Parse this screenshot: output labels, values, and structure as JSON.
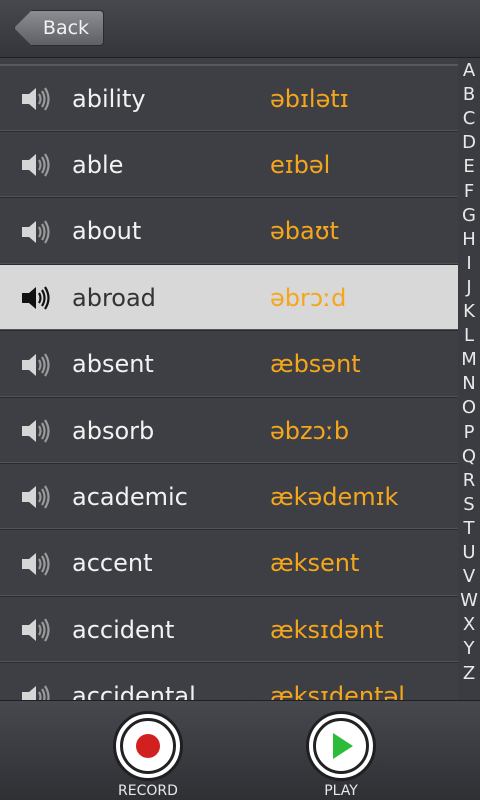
{
  "header": {
    "back_label": "Back"
  },
  "words": [
    {
      "word": "ability",
      "ipa": "əbɪlətɪ",
      "selected": false
    },
    {
      "word": "able",
      "ipa": "eɪbəl",
      "selected": false
    },
    {
      "word": "about",
      "ipa": "əbaʊt",
      "selected": false
    },
    {
      "word": "abroad",
      "ipa": "əbrɔːd",
      "selected": true
    },
    {
      "word": "absent",
      "ipa": "æbsənt",
      "selected": false
    },
    {
      "word": "absorb",
      "ipa": "əbzɔːb",
      "selected": false
    },
    {
      "word": "academic",
      "ipa": "ækədemɪk",
      "selected": false
    },
    {
      "word": "accent",
      "ipa": "æksent",
      "selected": false
    },
    {
      "word": "accident",
      "ipa": "æksɪdənt",
      "selected": false
    },
    {
      "word": "accidental",
      "ipa": "æksɪdentəl",
      "selected": false
    }
  ],
  "index_letters": [
    "A",
    "B",
    "C",
    "D",
    "E",
    "F",
    "G",
    "H",
    "I",
    "J",
    "K",
    "L",
    "M",
    "N",
    "O",
    "P",
    "Q",
    "R",
    "S",
    "T",
    "U",
    "V",
    "W",
    "X",
    "Y",
    "Z"
  ],
  "controls": {
    "record_label": "RECORD",
    "play_label": "PLAY"
  },
  "colors": {
    "ipa": "#f5a61b",
    "selected_row": "#d8d8d8",
    "record": "#d21f1f",
    "play": "#2bbd3a"
  },
  "icons": {
    "row_icon": "speaker-icon"
  }
}
